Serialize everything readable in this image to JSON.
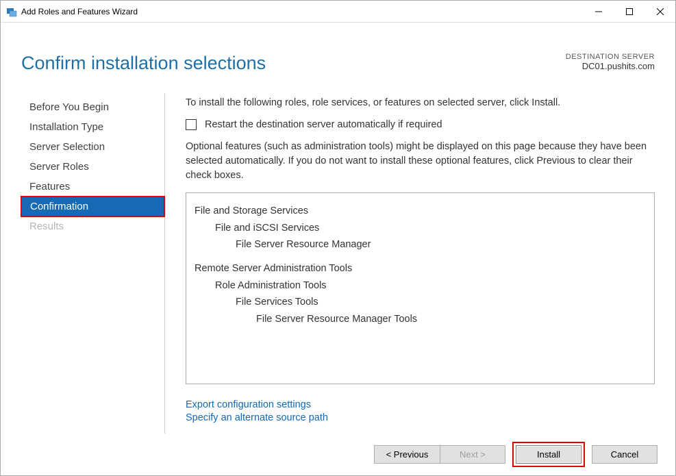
{
  "titlebar": {
    "title": "Add Roles and Features Wizard"
  },
  "header": {
    "page_title": "Confirm installation selections",
    "destination_label": "DESTINATION SERVER",
    "destination_server": "DC01.pushits.com"
  },
  "sidebar": {
    "items": [
      {
        "label": "Before You Begin"
      },
      {
        "label": "Installation Type"
      },
      {
        "label": "Server Selection"
      },
      {
        "label": "Server Roles"
      },
      {
        "label": "Features"
      },
      {
        "label": "Confirmation"
      },
      {
        "label": "Results"
      }
    ]
  },
  "content": {
    "instruction": "To install the following roles, role services, or features on selected server, click Install.",
    "restart_checkbox_label": "Restart the destination server automatically if required",
    "optional_note": "Optional features (such as administration tools) might be displayed on this page because they have been selected automatically. If you do not want to install these optional features, click Previous to clear their check boxes.",
    "tree": [
      {
        "level": 0,
        "text": "File and Storage Services"
      },
      {
        "level": 1,
        "text": "File and iSCSI Services"
      },
      {
        "level": 2,
        "text": "File Server Resource Manager"
      },
      {
        "level": 0,
        "text": "Remote Server Administration Tools",
        "gap": true
      },
      {
        "level": 1,
        "text": "Role Administration Tools"
      },
      {
        "level": 2,
        "text": "File Services Tools"
      },
      {
        "level": 3,
        "text": "File Server Resource Manager Tools"
      }
    ],
    "links": {
      "export": "Export configuration settings",
      "alt_source": "Specify an alternate source path"
    }
  },
  "footer": {
    "previous": "< Previous",
    "next": "Next >",
    "install": "Install",
    "cancel": "Cancel"
  }
}
